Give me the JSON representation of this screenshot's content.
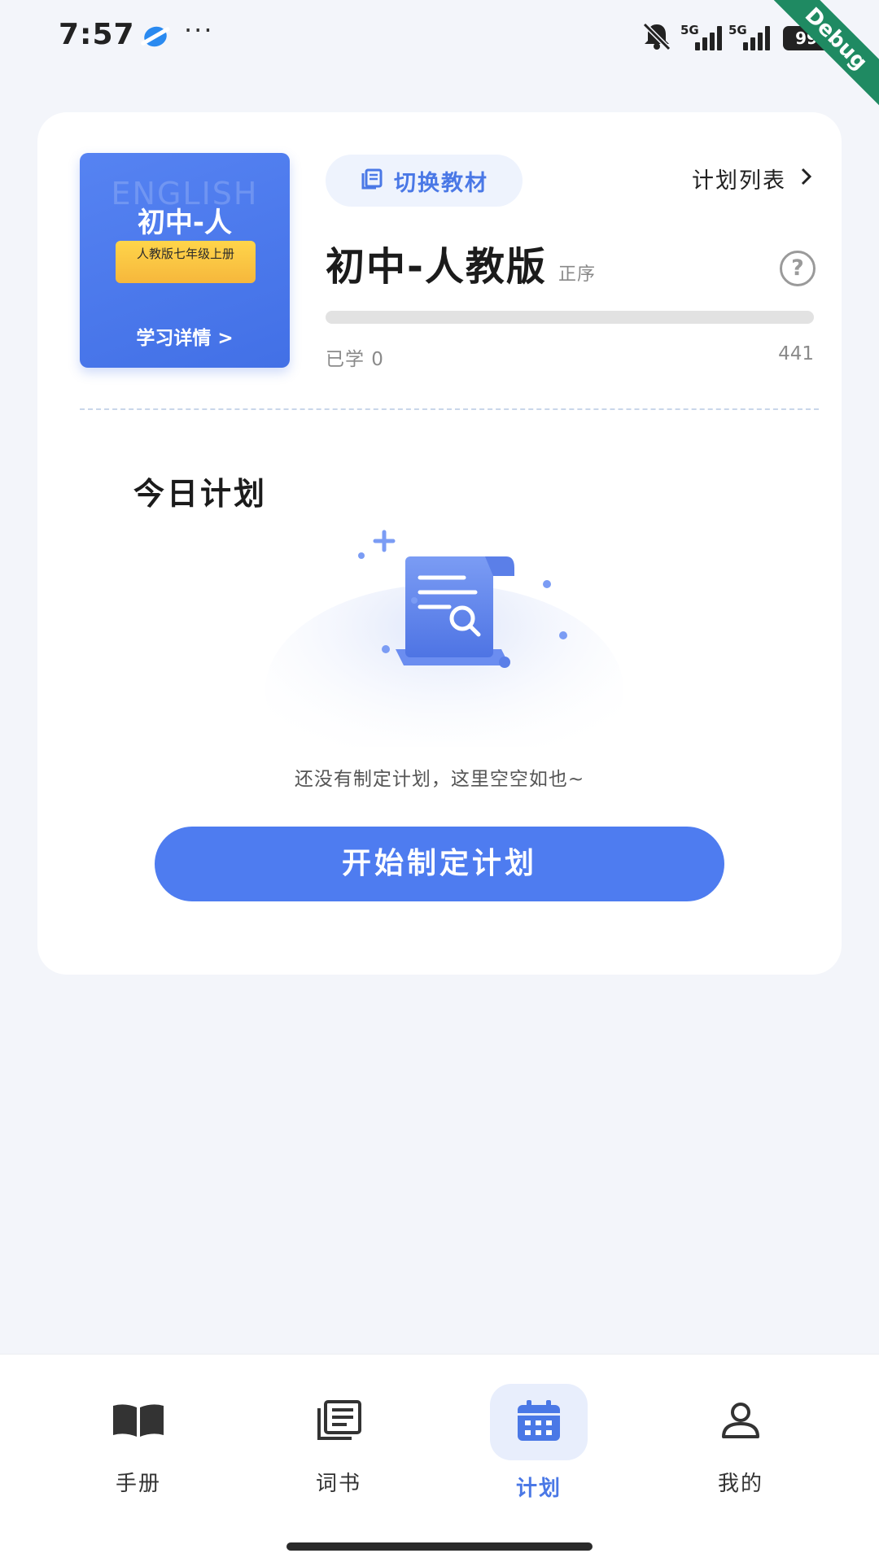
{
  "status_bar": {
    "time": "7:57",
    "more": "···",
    "network_1": "5G",
    "network_2": "5G",
    "battery": "99",
    "debug_ribbon": "Debug"
  },
  "book": {
    "cover_bg_text": "ENGLISH",
    "cover_title": "初中-人",
    "cover_label": "人教版七年级上册",
    "cover_detail": "学习详情 >",
    "name": "初中-人教版",
    "order": "正序",
    "learned_label": "已学 0",
    "learned_count": 0,
    "total": "441",
    "progress_fraction": 0
  },
  "header": {
    "switch_label": "切换教材",
    "plan_list_label": "计划列表"
  },
  "today": {
    "title": "今日计划",
    "empty_text": "还没有制定计划，这里空空如也~",
    "start_button": "开始制定计划"
  },
  "nav": {
    "items": [
      {
        "label": "手册",
        "icon": "book-open-icon",
        "active": false
      },
      {
        "label": "词书",
        "icon": "wordbook-icon",
        "active": false
      },
      {
        "label": "计划",
        "icon": "calendar-icon",
        "active": true
      },
      {
        "label": "我的",
        "icon": "person-icon",
        "active": false
      }
    ]
  },
  "colors": {
    "accent": "#4e7cf0",
    "background": "#f3f5fa",
    "card": "#ffffff"
  }
}
